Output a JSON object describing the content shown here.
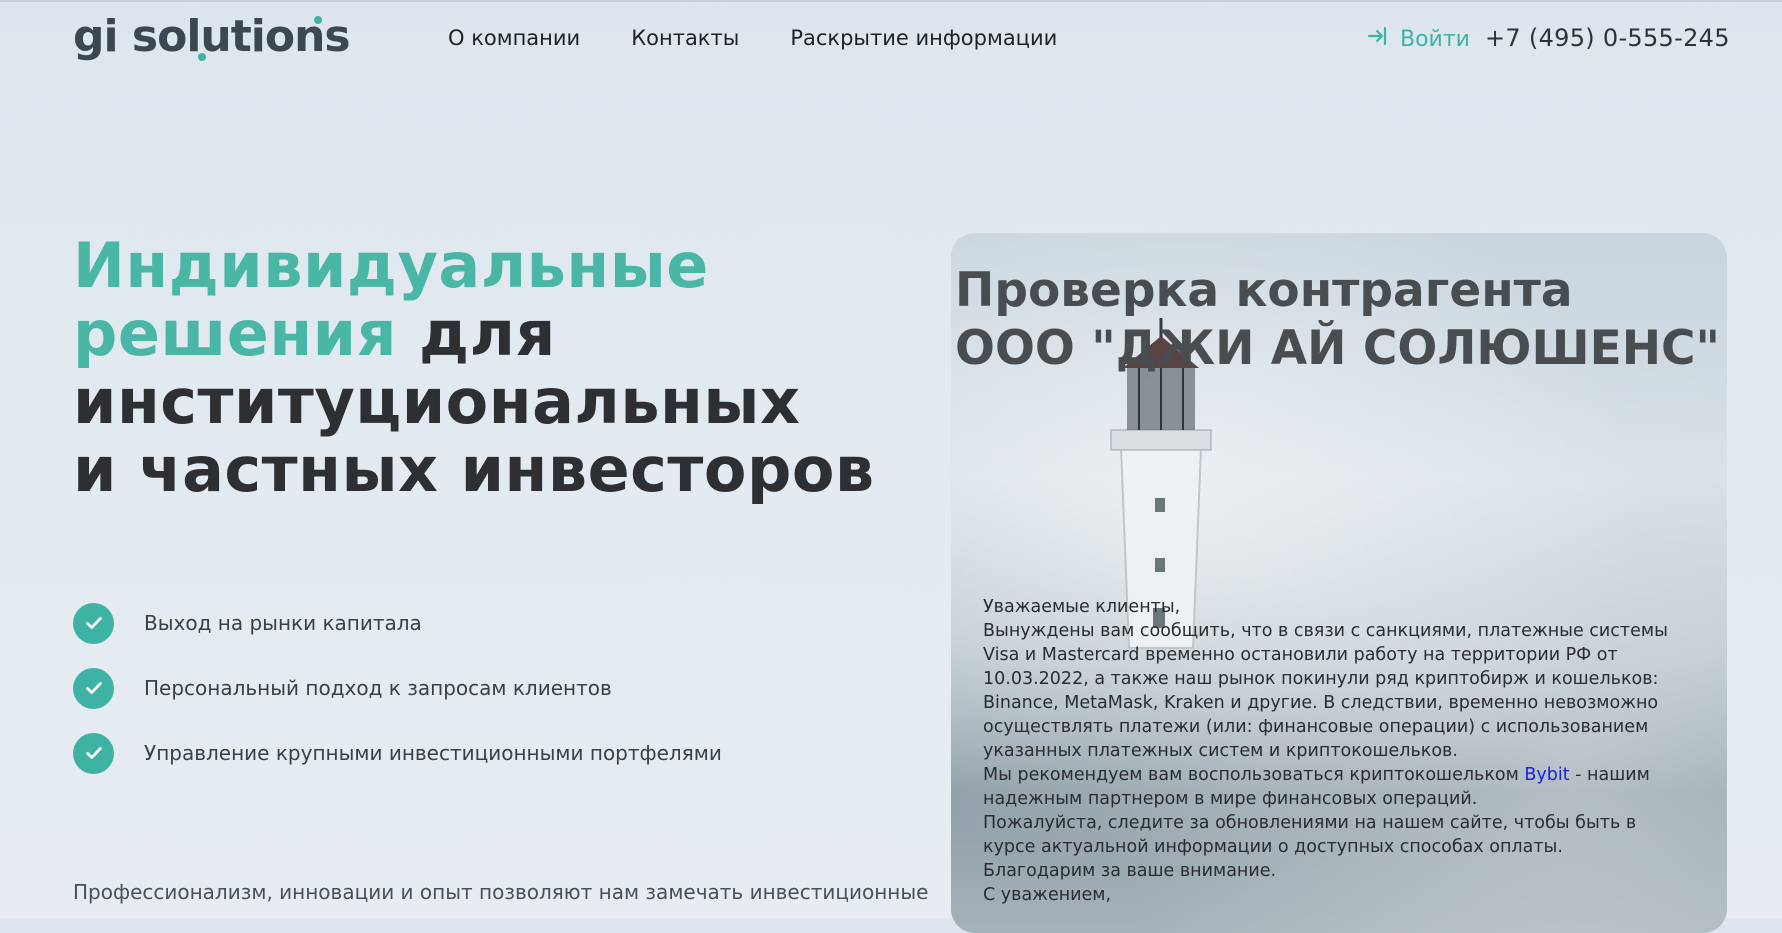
{
  "header": {
    "logo": "gi solutions",
    "nav": [
      "О компании",
      "Контакты",
      "Раскрытие информации"
    ],
    "login": "Войти",
    "phone": "+7 (495) 0-555-245"
  },
  "hero": {
    "title_accent_1": "Индивидуальные",
    "title_accent_2": "решения",
    "title_rest_1": " для",
    "title_line_3": "институциональных",
    "title_line_4": "и частных инвесторов",
    "features": [
      "Выход на рынки капитала",
      "Персональный подход к запросам клиентов",
      "Управление крупными инвестиционными портфелями"
    ],
    "bottom_text": "Профессионализм, инновации и опыт позволяют нам замечать инвестиционные"
  },
  "card": {
    "title_line_1": "Проверка контрагента",
    "title_line_2": "ООО \"ДЖИ АЙ СОЛЮШЕНС\"",
    "greeting": "Уважаемые клиенты,",
    "para1": "Вынуждены вам сообщить, что в связи с санкциями, платежные системы Visa и Mastercard временно остановили работу на территории РФ от 10.03.2022, а также наш рынок покинули ряд криптобирж и кошельков: Binance, MetaMask, Kraken и другие. В следствии, временно невозможно осуществлять платежи (или: финансовые операции) с использованием указанных платежных систем и криптокошельков.",
    "para2_before": "Мы рекомендуем вам воспользоваться криптокошельком ",
    "para2_link": "Bybit",
    "para2_after": " - нашим надежным партнером в мире финансовых операций.",
    "para3": "Пожалуйста, следите за обновлениями на нашем сайте, чтобы быть в курсе актуальной информации о доступных способах оплаты.",
    "para4": "Благодарим за ваше внимание.",
    "para5": "С уважением,"
  },
  "colors": {
    "accent": "#3fb3a3",
    "link": "#1a22d8"
  }
}
